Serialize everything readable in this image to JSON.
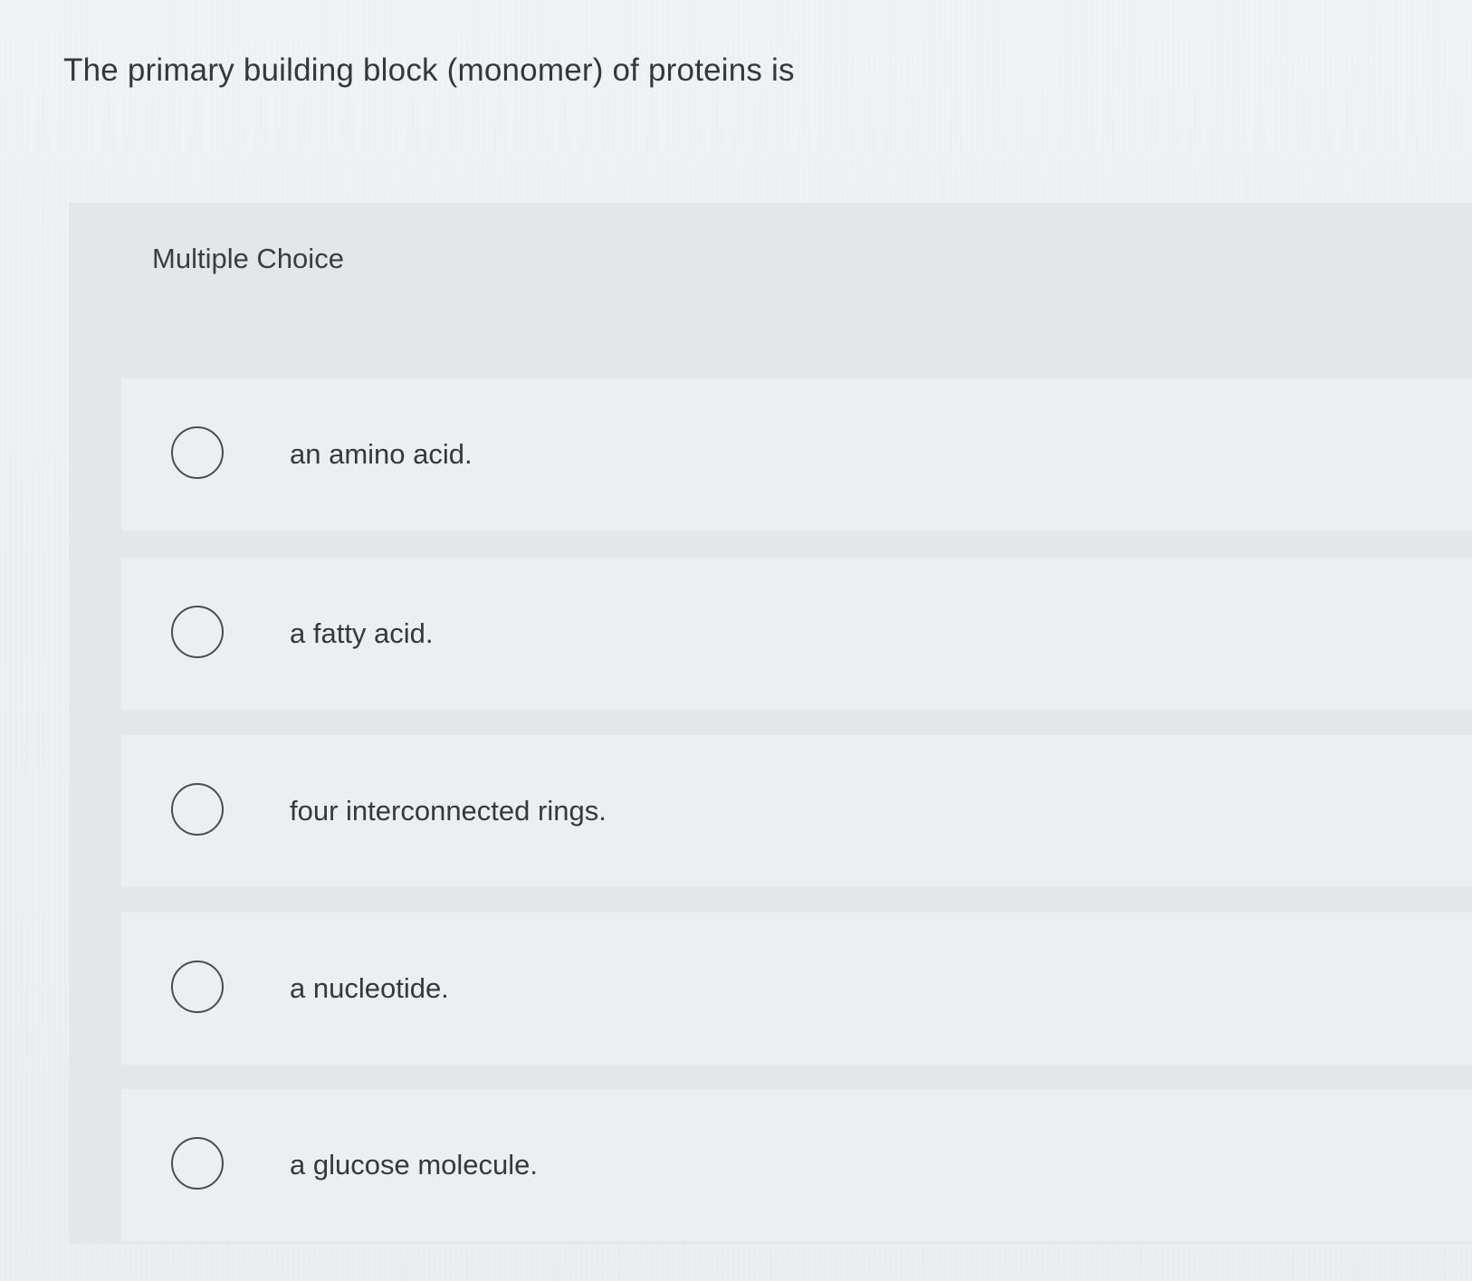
{
  "question": {
    "text": "The primary building block (monomer) of proteins is"
  },
  "question_type": "Multiple Choice",
  "options": [
    {
      "label": "an amino acid."
    },
    {
      "label": "a fatty acid."
    },
    {
      "label": "four interconnected rings."
    },
    {
      "label": "a nucleotide."
    },
    {
      "label": "a glucose molecule."
    }
  ],
  "colors": {
    "background": "#eaeeee",
    "panel": "#e3e7e7",
    "option_row": "#ecefef",
    "text": "#36393c"
  }
}
